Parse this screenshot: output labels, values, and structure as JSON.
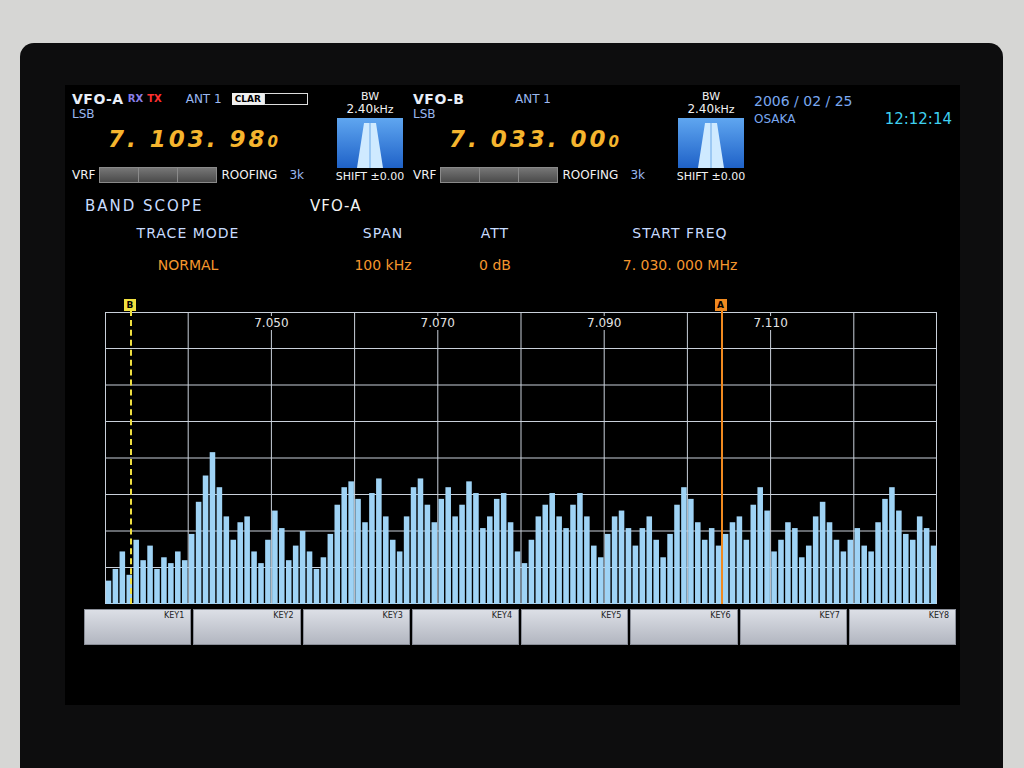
{
  "vfos": [
    {
      "name": "VFO-A",
      "rx": "RX",
      "tx": "TX",
      "mode": "LSB",
      "antenna": "ANT 1",
      "clar": "CLAR",
      "bw_label": "BW",
      "bw_value": "2.40",
      "bw_unit": "kHz",
      "freq": "7. 103. 98",
      "freq_tail": "0",
      "vrf": "VRF",
      "roofing": "ROOFING",
      "roofing_value": "3k",
      "shift": "SHIFT ±0.00",
      "marker": "A",
      "marker_color": "#f08a20",
      "marker_kind": "solid"
    },
    {
      "name": "VFO-B",
      "mode": "LSB",
      "antenna": "ANT 1",
      "bw_label": "BW",
      "bw_value": "2.40",
      "bw_unit": "kHz",
      "freq": "7. 033. 00",
      "freq_tail": "0",
      "vrf": "VRF",
      "roofing": "ROOFING",
      "roofing_value": "3k",
      "shift": "SHIFT ±0.00",
      "marker": "B",
      "marker_color": "#f0e040",
      "marker_kind": "dashed"
    }
  ],
  "clock": {
    "date": "2006 / 02 / 25",
    "location": "OSAKA",
    "time": "12:12:14"
  },
  "scope": {
    "title": "BAND SCOPE",
    "source": "VFO-A",
    "fields": [
      {
        "label": "TRACE MODE",
        "value": "NORMAL"
      },
      {
        "label": "SPAN",
        "value": "100 kHz"
      },
      {
        "label": "ATT",
        "value": "0 dB"
      },
      {
        "label": "START FREQ",
        "value": "7. 030. 000 MHz"
      }
    ]
  },
  "chart": {
    "x_ticks": [
      "7.050",
      "7.070",
      "7.090",
      "7.110"
    ],
    "series": [
      {
        "name": "signal",
        "values": [
          8,
          12,
          18,
          10,
          22,
          15,
          20,
          12,
          16,
          14,
          18,
          15,
          24,
          35,
          44,
          52,
          40,
          30,
          22,
          28,
          30,
          18,
          14,
          22,
          32,
          26,
          15,
          20,
          25,
          18,
          12,
          16,
          24,
          34,
          40,
          42,
          36,
          28,
          38,
          43,
          30,
          22,
          18,
          30,
          40,
          43,
          34,
          28,
          36,
          40,
          30,
          34,
          42,
          38,
          26,
          30,
          36,
          38,
          28,
          18,
          14,
          22,
          30,
          34,
          38,
          30,
          26,
          34,
          38,
          30,
          20,
          16,
          24,
          30,
          32,
          26,
          20,
          26,
          30,
          22,
          16,
          24,
          34,
          40,
          36,
          28,
          22,
          26,
          20,
          24,
          28,
          30,
          22,
          34,
          40,
          32,
          18,
          22,
          28,
          26,
          16,
          20,
          30,
          35,
          28,
          22,
          18,
          22,
          26,
          20,
          18,
          28,
          36,
          40,
          32,
          24,
          22,
          30,
          26,
          20
        ]
      }
    ]
  },
  "keys": [
    "KEY1",
    "KEY2",
    "KEY3",
    "KEY4",
    "KEY5",
    "KEY6",
    "KEY7",
    "KEY8"
  ]
}
